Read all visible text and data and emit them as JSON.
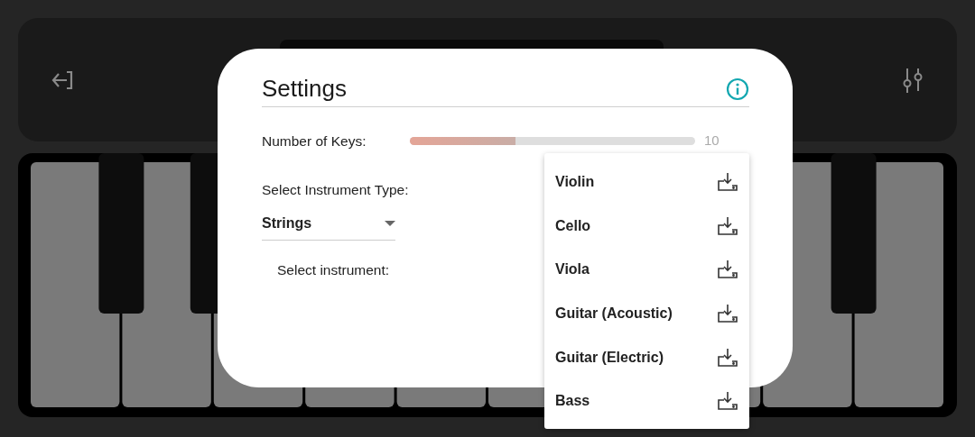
{
  "dialog": {
    "title": "Settings",
    "keys": {
      "label": "Number of Keys:",
      "level": 0.37,
      "reading": "10"
    },
    "instrument_type": {
      "label": "Select Instrument Type:",
      "value": "Strings"
    },
    "instrument": {
      "label": "Select instrument:"
    }
  },
  "instrument_menu": [
    {
      "label": "Violin"
    },
    {
      "label": "Cello"
    },
    {
      "label": "Viola"
    },
    {
      "label": "Guitar (Acoustic)"
    },
    {
      "label": "Guitar (Electric)"
    },
    {
      "label": "Bass"
    }
  ]
}
